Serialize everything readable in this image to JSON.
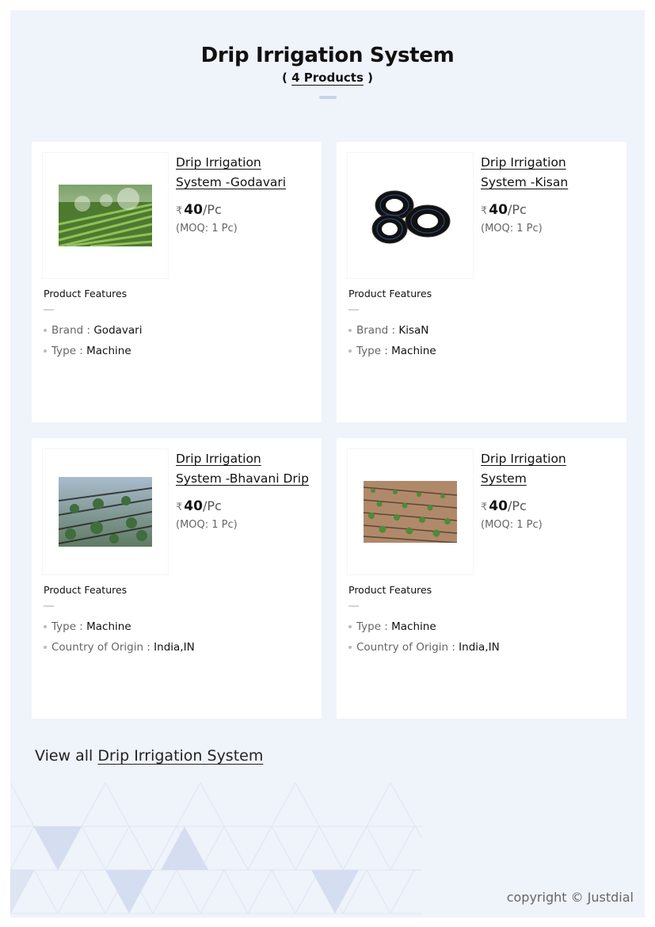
{
  "header": {
    "title": "Drip Irrigation System",
    "count_open": "( ",
    "count_text": "4 Products",
    "count_close": " )"
  },
  "products": [
    {
      "name": "Drip Irrigation System -Godavari",
      "currency_symbol": "₹",
      "price": "40",
      "unit": "/Pc",
      "moq": "(MOQ: 1 Pc)",
      "image_icon": "field-sprinkler-photo",
      "features_title": "Product Features",
      "features": [
        {
          "label": "Brand : ",
          "value": "Godavari"
        },
        {
          "label": "Type : ",
          "value": "Machine"
        }
      ]
    },
    {
      "name": "Drip Irrigation System -Kisan",
      "currency_symbol": "₹",
      "price": "40",
      "unit": "/Pc",
      "moq": "(MOQ: 1 Pc)",
      "image_icon": "pipe-coils-photo",
      "features_title": "Product Features",
      "features": [
        {
          "label": "Brand : ",
          "value": "KisaN"
        },
        {
          "label": "Type : ",
          "value": "Machine"
        }
      ]
    },
    {
      "name": "Drip Irrigation System -Bhavani Drip",
      "currency_symbol": "₹",
      "price": "40",
      "unit": "/Pc",
      "moq": "(MOQ: 1 Pc)",
      "image_icon": "crop-rows-photo",
      "features_title": "Product Features",
      "features": [
        {
          "label": "Type : ",
          "value": "Machine"
        },
        {
          "label": "Country of Origin : ",
          "value": "India,IN"
        }
      ]
    },
    {
      "name": "Drip Irrigation System",
      "currency_symbol": "₹",
      "price": "40",
      "unit": "/Pc",
      "moq": "(MOQ: 1 Pc)",
      "image_icon": "seedling-rows-photo",
      "features_title": "Product Features",
      "features": [
        {
          "label": "Type : ",
          "value": "Machine"
        },
        {
          "label": "Country of Origin : ",
          "value": "India,IN"
        }
      ]
    }
  ],
  "footer": {
    "view_all_prefix": "View all ",
    "view_all_link": "Drip Irrigation System",
    "copyright": "copyright © Justdial"
  },
  "colors": {
    "sheet_bg": "#eff3fa",
    "card_bg": "#ffffff",
    "pattern": "#dbe3f1"
  }
}
